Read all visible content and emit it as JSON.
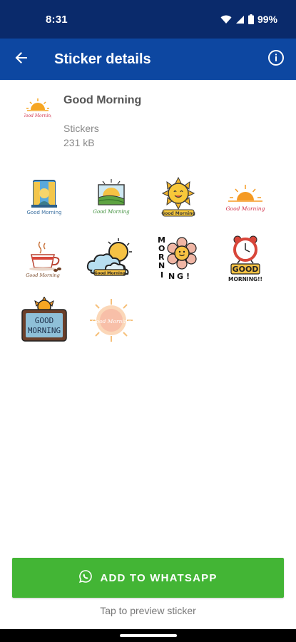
{
  "status_bar": {
    "time": "8:31",
    "battery": "99%",
    "icons": [
      "wifi-icon",
      "signal-icon",
      "battery-icon"
    ]
  },
  "app_bar": {
    "title": "Sticker details",
    "back_icon": "arrow-left-icon",
    "info_icon": "info-icon"
  },
  "pack": {
    "title": "Good Morning",
    "publisher": "Stickers",
    "size": "231 kB"
  },
  "stickers": [
    {
      "name": "sticker-good-morning-window",
      "caption": "Good Morning"
    },
    {
      "name": "sticker-sunrise-field",
      "caption": "Good Morning"
    },
    {
      "name": "sticker-smiling-sun",
      "caption": "Good Morning"
    },
    {
      "name": "sticker-sunrise-lines",
      "caption": "Good Morning"
    },
    {
      "name": "sticker-coffee-cup",
      "caption": "Good Morning"
    },
    {
      "name": "sticker-sun-clouds",
      "caption": "Good Morning"
    },
    {
      "name": "sticker-morning-flower",
      "caption": "MORNING!",
      "letters": [
        "M",
        "O",
        "R",
        "N",
        "I",
        "N",
        "G",
        "!"
      ]
    },
    {
      "name": "sticker-alarm-clock",
      "caption": "GOOD",
      "caption2": "MORNING!!"
    },
    {
      "name": "sticker-good-morning-board",
      "caption": "GOOD",
      "caption2": "MORNING"
    },
    {
      "name": "sticker-good-morning-glow",
      "caption": "Good Morning"
    }
  ],
  "actions": {
    "add_label": "ADD TO WHATSAPP",
    "hint": "Tap to preview sticker"
  },
  "colors": {
    "status_bar": "#0a2a6b",
    "app_bar": "#0d47a1",
    "add_button": "#43b535"
  }
}
